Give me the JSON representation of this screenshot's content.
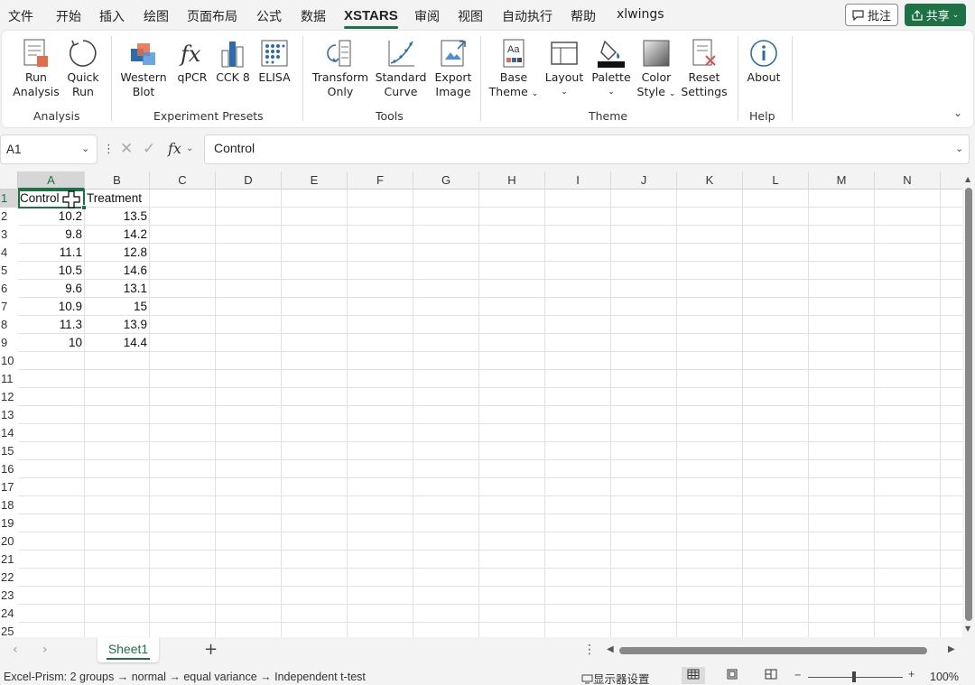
{
  "menu": {
    "tabs": [
      "文件",
      "开始",
      "插入",
      "绘图",
      "页面布局",
      "公式",
      "数据",
      "XSTARS",
      "审阅",
      "视图",
      "自动执行",
      "帮助",
      "xlwings"
    ],
    "active_tab": "XSTARS",
    "comment_label": "批注",
    "share_label": "共享"
  },
  "ribbon": {
    "groups": [
      {
        "label": "Analysis",
        "buttons": [
          {
            "line1": "Run",
            "line2": "Analysis",
            "icon": "run-analysis-icon"
          },
          {
            "line1": "Quick",
            "line2": "Run",
            "icon": "quick-run-icon"
          }
        ]
      },
      {
        "label": "Experiment Presets",
        "buttons": [
          {
            "line1": "Western",
            "line2": "Blot",
            "icon": "western-blot-icon"
          },
          {
            "line1": "qPCR",
            "line2": "",
            "icon": "qpcr-icon"
          },
          {
            "line1": "CCK 8",
            "line2": "",
            "icon": "cck8-icon"
          },
          {
            "line1": "ELISA",
            "line2": "",
            "icon": "elisa-icon"
          }
        ]
      },
      {
        "label": "Tools",
        "buttons": [
          {
            "line1": "Transform",
            "line2": "Only",
            "icon": "transform-icon"
          },
          {
            "line1": "Standard",
            "line2": "Curve",
            "icon": "standard-curve-icon"
          },
          {
            "line1": "Export",
            "line2": "Image",
            "icon": "export-image-icon"
          }
        ]
      },
      {
        "label": "Theme",
        "buttons": [
          {
            "line1": "Base",
            "line2": "Theme",
            "icon": "base-theme-icon"
          },
          {
            "line1": "Layout",
            "line2": "",
            "icon": "layout-icon"
          },
          {
            "line1": "Palette",
            "line2": "",
            "icon": "palette-icon"
          },
          {
            "line1": "Color",
            "line2": "Style",
            "icon": "color-style-icon"
          },
          {
            "line1": "Reset",
            "line2": "Settings",
            "icon": "reset-settings-icon"
          }
        ]
      },
      {
        "label": "Help",
        "buttons": [
          {
            "line1": "About",
            "line2": "",
            "icon": "about-icon"
          }
        ]
      }
    ]
  },
  "formula_bar": {
    "name_box": "A1",
    "fx_label": "fx",
    "content": "Control"
  },
  "sheet": {
    "columns": [
      "A",
      "B",
      "C",
      "D",
      "E",
      "F",
      "G",
      "H",
      "I",
      "J",
      "K",
      "L",
      "M",
      "N"
    ],
    "rows": [
      "1",
      "2",
      "3",
      "4",
      "5",
      "6",
      "7",
      "8",
      "9",
      "10",
      "11",
      "12",
      "13",
      "14",
      "15",
      "16",
      "17",
      "18",
      "19",
      "20",
      "21",
      "22",
      "23",
      "24",
      "25"
    ],
    "headers": [
      "Control",
      "Treatment"
    ],
    "control": [
      "10.2",
      "9.8",
      "11.1",
      "10.5",
      "9.6",
      "10.9",
      "11.3",
      "10"
    ],
    "treatment": [
      "13.5",
      "14.2",
      "12.8",
      "14.6",
      "13.1",
      "15",
      "13.9",
      "14.4"
    ],
    "selected_cell": "A1"
  },
  "tabs": {
    "sheet_name": "Sheet1"
  },
  "status": {
    "text": "Excel-Prism: 2 groups → normal → equal variance → Independent t-test",
    "display_settings": "显示器设置",
    "zoom": "100%"
  },
  "colors": {
    "accent": "#1e7145"
  }
}
